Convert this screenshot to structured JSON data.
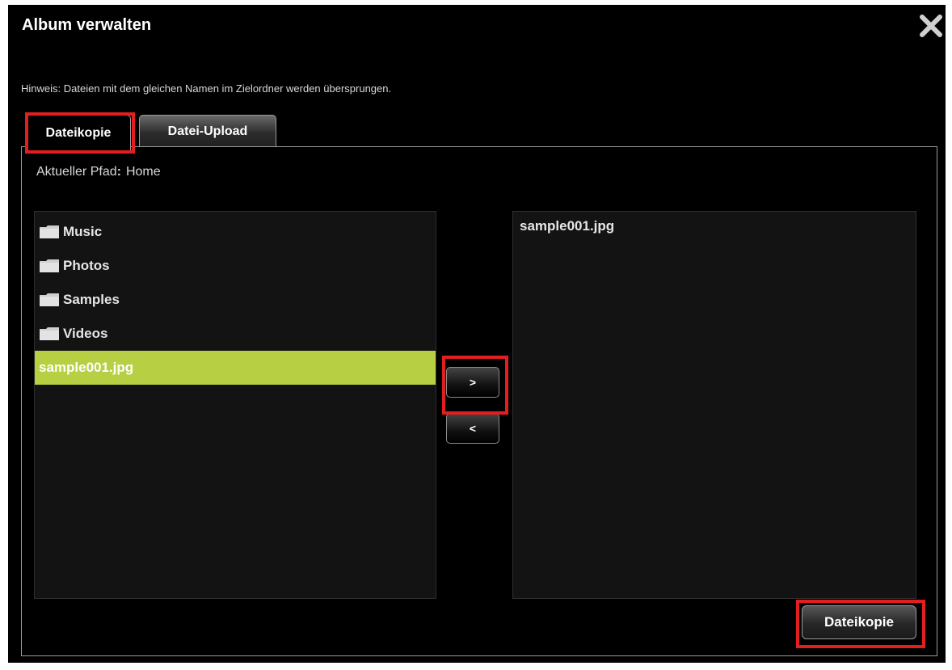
{
  "dialog": {
    "title": "Album verwalten",
    "close_icon": "close-icon",
    "hint": "Hinweis: Dateien mit dem gleichen Namen im Zielordner werden übersprungen."
  },
  "tabs": [
    {
      "label": "Dateikopie",
      "active": true
    },
    {
      "label": "Datei-Upload",
      "active": false
    }
  ],
  "path": {
    "label": "Aktueller Pfad",
    "colon": ":",
    "value": "Home"
  },
  "source_list": {
    "items": [
      {
        "label": "Music",
        "type": "folder",
        "icon": "folder-icon"
      },
      {
        "label": "Photos",
        "type": "folder",
        "icon": "folder-icon"
      },
      {
        "label": "Samples",
        "type": "folder",
        "icon": "folder-icon"
      },
      {
        "label": "Videos",
        "type": "folder",
        "icon": "folder-icon"
      },
      {
        "label": "sample001.jpg",
        "type": "file",
        "selected": true
      }
    ]
  },
  "target_list": {
    "items": [
      {
        "label": "sample001.jpg"
      }
    ]
  },
  "buttons": {
    "move_right": ">",
    "move_left": "<",
    "action": "Dateikopie"
  },
  "colors": {
    "background": "#000000",
    "selected_row": "#b7cf43",
    "highlight": "#e31e1e",
    "list_bg": "#131313"
  }
}
